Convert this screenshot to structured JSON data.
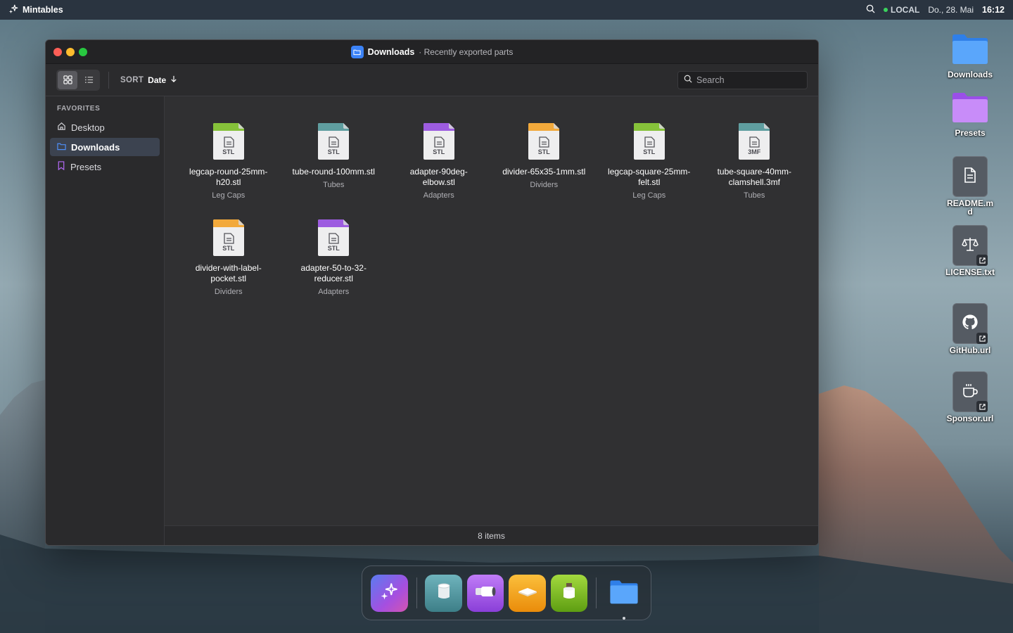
{
  "menubar": {
    "app_name": "Mintables",
    "status": "LOCAL",
    "date": "Do., 28. Mai",
    "time": "16:12",
    "icons": [
      "sparkle-icon",
      "search-icon"
    ]
  },
  "window": {
    "title": "Downloads",
    "subtitle": "Recently exported parts",
    "toolbar": {
      "sort_label": "SORT",
      "sort_value": "Date",
      "search_placeholder": "Search"
    },
    "sidebar": {
      "heading": "FAVORITES",
      "items": [
        {
          "label": "Desktop",
          "icon": "home-icon",
          "active": false
        },
        {
          "label": "Downloads",
          "icon": "folder-icon",
          "active": true
        },
        {
          "label": "Presets",
          "icon": "bookmark-icon",
          "active": false
        }
      ]
    },
    "files": [
      {
        "name": "legcap-round-25mm-h20.stl",
        "category": "Leg Caps",
        "ext": "STL",
        "color": "#86c23a"
      },
      {
        "name": "tube-round-100mm.stl",
        "category": "Tubes",
        "ext": "STL",
        "color": "#5f9ea0"
      },
      {
        "name": "adapter-90deg-elbow.stl",
        "category": "Adapters",
        "ext": "STL",
        "color": "#9d5ce0"
      },
      {
        "name": "divider-65x35-1mm.stl",
        "category": "Dividers",
        "ext": "STL",
        "color": "#f2a93b"
      },
      {
        "name": "legcap-square-25mm-felt.stl",
        "category": "Leg Caps",
        "ext": "STL",
        "color": "#86c23a"
      },
      {
        "name": "tube-square-40mm-clamshell.3mf",
        "category": "Tubes",
        "ext": "3MF",
        "color": "#5f9ea0"
      },
      {
        "name": "divider-with-label-pocket.stl",
        "category": "Dividers",
        "ext": "STL",
        "color": "#f2a93b"
      },
      {
        "name": "adapter-50-to-32-reducer.stl",
        "category": "Adapters",
        "ext": "STL",
        "color": "#9d5ce0"
      }
    ],
    "status": "8 items"
  },
  "desktop": [
    {
      "label": "Downloads",
      "kind": "folder",
      "color": "#3b8ef5"
    },
    {
      "label": "Presets",
      "kind": "folder",
      "color": "#a855f7"
    },
    {
      "label": "README.md",
      "kind": "document",
      "icon": "document-icon"
    },
    {
      "label": "LICENSE.txt",
      "kind": "link",
      "icon": "scale-icon"
    },
    {
      "label": "GitHub.url",
      "kind": "link",
      "icon": "github-icon"
    },
    {
      "label": "Sponsor.url",
      "kind": "link",
      "icon": "coffee-icon"
    }
  ],
  "dock": [
    {
      "name": "mintables-app",
      "icon": "sparkle-icon",
      "color": "#8b5cf6"
    },
    {
      "name": "tube-app",
      "icon": "cylinder-icon",
      "color": "#4b9aa5"
    },
    {
      "name": "adapter-app",
      "icon": "pipe-icon",
      "color": "#a855f7"
    },
    {
      "name": "divider-app",
      "icon": "plate-icon",
      "color": "#f59e0b"
    },
    {
      "name": "legcap-app",
      "icon": "cap-icon",
      "color": "#84cc16"
    },
    {
      "name": "files-app",
      "icon": "folder-icon",
      "color": "#3b82f6",
      "running": true
    }
  ]
}
